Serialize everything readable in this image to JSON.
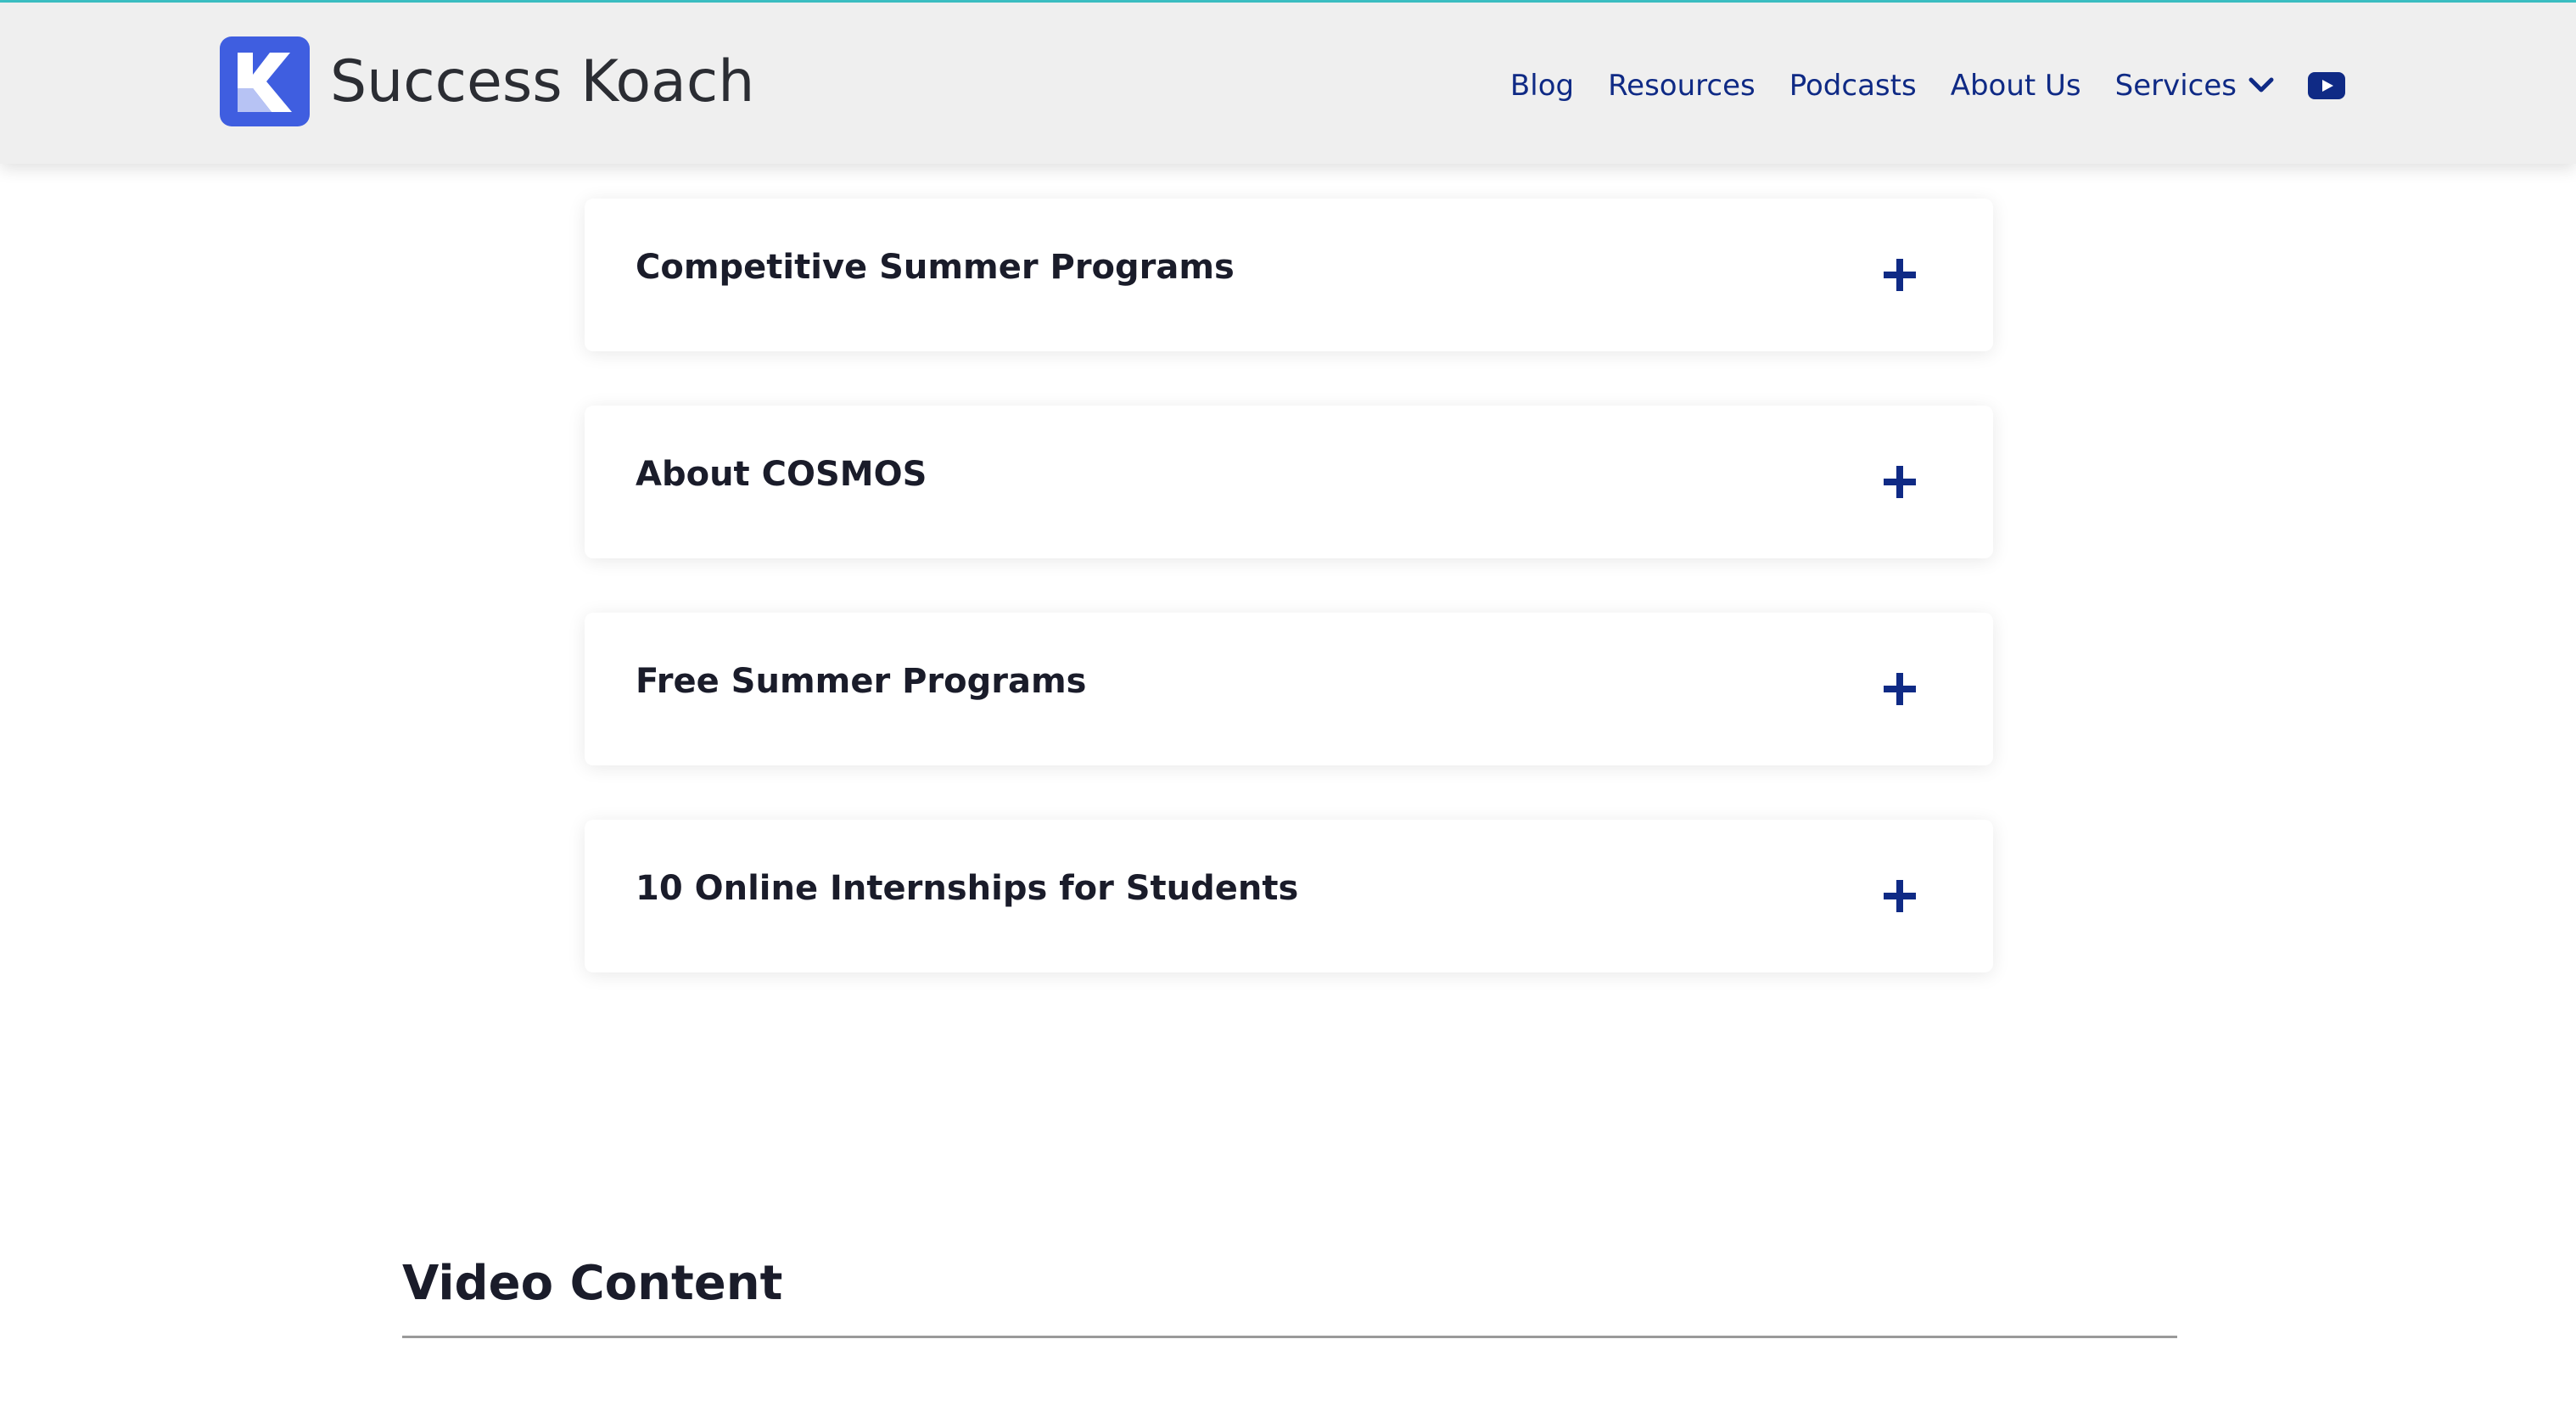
{
  "header": {
    "brand_name": "Success Koach",
    "logo_icon": "k-logo-icon",
    "nav": [
      {
        "label": "Blog"
      },
      {
        "label": "Resources"
      },
      {
        "label": "Podcasts"
      },
      {
        "label": "About Us"
      },
      {
        "label": "Services",
        "icon": "chevron-down-icon"
      }
    ],
    "social_icon": "youtube-icon"
  },
  "accordion": {
    "items": [
      {
        "title": "Competitive Summer Programs",
        "icon": "plus-icon"
      },
      {
        "title": "About COSMOS",
        "icon": "plus-icon"
      },
      {
        "title": "Free Summer Programs",
        "icon": "plus-icon"
      },
      {
        "title": "10 Online Internships for Students",
        "icon": "plus-icon"
      }
    ]
  },
  "video_section": {
    "title": "Video Content"
  },
  "colors": {
    "brand_blue": "#3f5ee0",
    "nav_text": "#0f2a85",
    "header_bg": "#efefef",
    "top_accent": "#3cc2c6",
    "icon_navy": "#0f2a85"
  }
}
